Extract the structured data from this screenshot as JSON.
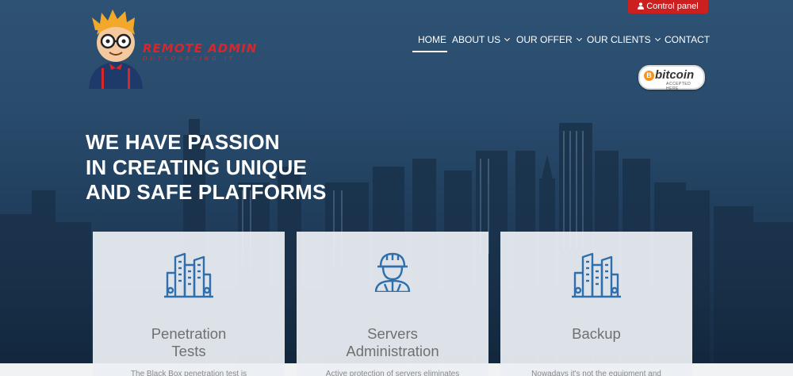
{
  "control_panel": {
    "label": "Control panel",
    "icon": "user-icon"
  },
  "logo": {
    "title": "REMOTE ADMIN",
    "subtitle": "OUTSOURCING IT",
    "icon": "nerd-mascot-icon"
  },
  "nav": {
    "items": [
      {
        "label": "HOME",
        "active": true,
        "dropdown": false
      },
      {
        "label": "ABOUT US",
        "active": false,
        "dropdown": true
      },
      {
        "label": "OUR OFFER",
        "active": false,
        "dropdown": true
      },
      {
        "label": "OUR CLIENTS",
        "active": false,
        "dropdown": true
      },
      {
        "label": "CONTACT",
        "active": false,
        "dropdown": false
      }
    ]
  },
  "bitcoin_badge": {
    "word": "bitcoin",
    "coin_symbol": "B",
    "sub": "ACCEPTED HERE"
  },
  "hero": {
    "headline_lines": [
      "WE HAVE PASSION",
      "IN CREATING UNIQUE",
      "AND SAFE PLATFORMS"
    ]
  },
  "cards": [
    {
      "icon": "buildings-icon",
      "title_lines": [
        "Penetration",
        "Tests"
      ],
      "description": "The Black Box penetration test is"
    },
    {
      "icon": "worker-icon",
      "title_lines": [
        "Servers",
        "Administration"
      ],
      "description": "Active protection of servers eliminates"
    },
    {
      "icon": "buildings-icon",
      "title_lines": [
        "Backup"
      ],
      "description": "Nowadays it's not the equipment and"
    }
  ],
  "colors": {
    "accent_red": "#cc1f1f",
    "icon_blue": "#2f6fae",
    "card_title": "#707070"
  }
}
